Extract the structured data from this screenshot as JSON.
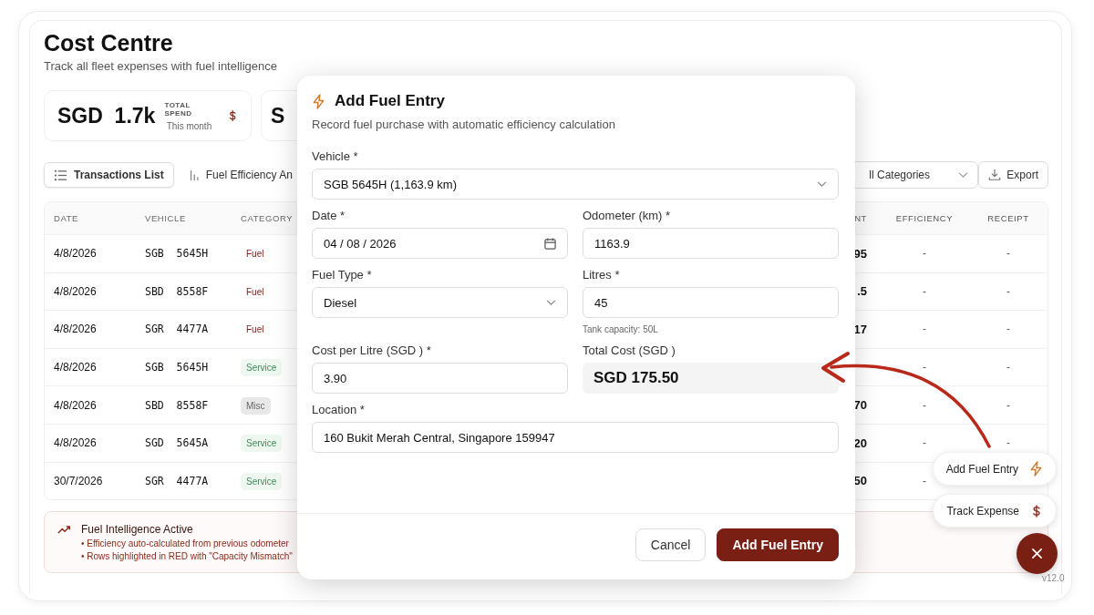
{
  "page": {
    "title": "Cost Centre",
    "subtitle": "Track all fleet expenses with fuel intelligence"
  },
  "stats": [
    {
      "value": "SGD  1.7k",
      "label": "TOTAL SPEND",
      "sublabel": "This month"
    },
    {
      "value": "S"
    }
  ],
  "view_tabs": [
    {
      "label": "Transactions List",
      "selected": true
    },
    {
      "label": "Fuel Efficiency An",
      "selected": false
    }
  ],
  "category_filter": {
    "value": "ll Categories"
  },
  "export_button": "Export",
  "table": {
    "columns": [
      "DATE",
      "VEHICLE",
      "CATEGORY",
      "NT",
      "EFFICIENCY",
      "RECEIPT"
    ],
    "rows": [
      {
        "date": "4/8/2026",
        "vehicle": "SGB  5645H",
        "category": "Fuel",
        "kind": "fuel",
        "amount": "95",
        "efficiency": "-",
        "receipt": "-"
      },
      {
        "date": "4/8/2026",
        "vehicle": "SBD  8558F",
        "category": "Fuel",
        "kind": "fuel",
        "amount": ".5",
        "efficiency": "-",
        "receipt": "-"
      },
      {
        "date": "4/8/2026",
        "vehicle": "SGR  4477A",
        "category": "Fuel",
        "kind": "fuel",
        "amount": "17",
        "efficiency": "-",
        "receipt": "-"
      },
      {
        "date": "4/8/2026",
        "vehicle": "SGB  5645H",
        "category": "Service",
        "kind": "service",
        "efficiency": "-",
        "receipt": "-"
      },
      {
        "date": "4/8/2026",
        "vehicle": "SBD  8558F",
        "category": "Misc",
        "kind": "misc",
        "amount": "70",
        "efficiency": "-",
        "receipt": "-"
      },
      {
        "date": "4/8/2026",
        "vehicle": "SGD  5645A",
        "category": "Service",
        "kind": "service",
        "amount": "20",
        "efficiency": "-",
        "receipt": "-"
      },
      {
        "date": "30/7/2026",
        "vehicle": "SGR  4477A",
        "category": "Service",
        "kind": "service",
        "amount": "50",
        "efficiency": "-"
      }
    ]
  },
  "info": {
    "title": "Fuel Intelligence Active",
    "lines": [
      "• Efficiency auto-calculated from previous odometer",
      "• Rows highlighted in RED with \"Capacity Mismatch\""
    ]
  },
  "modal": {
    "title": "Add Fuel Entry",
    "subtitle": "Record fuel purchase with automatic efficiency calculation",
    "rows": [
      [
        {
          "kind": "select",
          "label": "Vehicle *",
          "value": "SGB 5645H (1,163.9 km)"
        }
      ],
      [
        {
          "kind": "date",
          "label": "Date *",
          "value": "04 / 08 / 2026"
        },
        {
          "kind": "input",
          "label": "Odometer (km) *",
          "value": "1163.9"
        }
      ],
      [
        {
          "kind": "select",
          "label": "Fuel Type *",
          "value": "Diesel"
        },
        {
          "kind": "input",
          "label": "Litres *",
          "value": "45",
          "hint": "Tank capacity: 50L"
        }
      ],
      [
        {
          "kind": "input",
          "label": "Cost per Litre (SGD ) *",
          "value": "3.90"
        },
        {
          "kind": "total",
          "label": "Total Cost (SGD )",
          "value": "SGD 175.50"
        }
      ],
      [
        {
          "kind": "input",
          "label": "Location *",
          "value": "160 Bukit Merah Central, Singapore 159947"
        }
      ]
    ],
    "buttons": [
      {
        "label": "Cancel",
        "kind": "secondary"
      },
      {
        "label": "Add Fuel Entry",
        "kind": "primary"
      }
    ]
  },
  "fab_menu": [
    {
      "label": "Add Fuel Entry"
    },
    {
      "label": "Track Expense"
    }
  ],
  "version": "v12.0"
}
